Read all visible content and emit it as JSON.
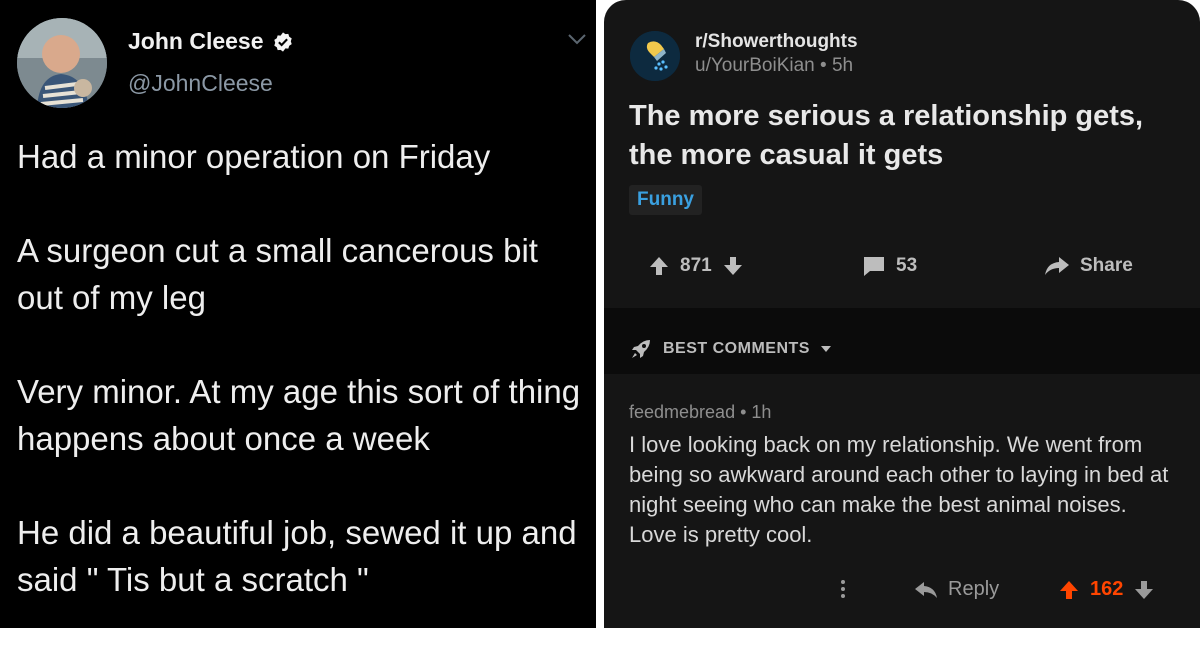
{
  "tweet": {
    "name": "John Cleese",
    "handle": "@JohnCleese",
    "paragraphs": [
      "Had a minor operation on Friday",
      "A surgeon cut a small cancerous bit out of my leg",
      "Very minor. At my age this sort of thing happens about once a week",
      "He did a beautiful job, sewed it up and said \" Tis but a scratch \""
    ],
    "icons": {
      "verified": "verified-badge-icon",
      "more": "chevron-down-icon"
    }
  },
  "reddit": {
    "subreddit": "r/Showerthoughts",
    "author": "u/YourBoiKian",
    "age": "5h",
    "title": "The more serious a relationship gets, the more casual it gets",
    "flair": "Funny",
    "score": "871",
    "comment_count": "53",
    "share_label": "Share",
    "sort_label": "BEST COMMENTS",
    "comment": {
      "author": "feedmebread",
      "age": "1h",
      "body": "I love looking back on my relationship. We went from being so awkward around each other to laying in bed at night seeing who can make the best animal noises. Love is pretty cool.",
      "reply_label": "Reply",
      "score": "162"
    },
    "colors": {
      "upvote": "#ff4500",
      "flair": "#3aa0e0",
      "background": "#151515"
    }
  }
}
